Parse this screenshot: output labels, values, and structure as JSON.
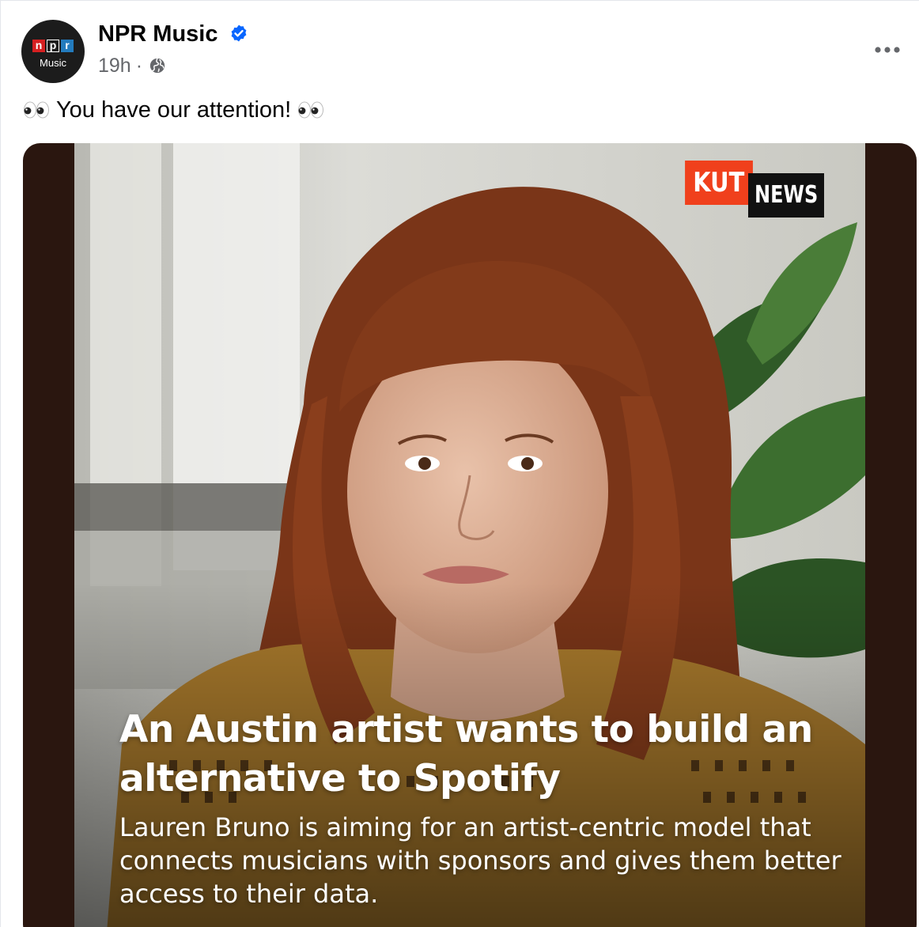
{
  "post": {
    "page_name": "NPR Music",
    "verified": true,
    "timestamp": "19h",
    "separator": "·",
    "audience_icon": "globe-icon",
    "more_icon": "more-options-icon",
    "caption_text": "You have our attention!",
    "caption_emoji": "eyes-emoji"
  },
  "avatar": {
    "logo_letters": [
      "n",
      "p",
      "r"
    ],
    "subtitle": "Music"
  },
  "media": {
    "badge_primary": "KUT",
    "badge_secondary": "NEWS",
    "headline": "An Austin artist wants to build an alternative to Spotify",
    "subheadline": "Lauren Bruno is aiming for an artist-centric model that connects musicians with sponsors and gives them better access to their data."
  },
  "colors": {
    "verified_blue": "#0866ff",
    "npr_red": "#d62021",
    "npr_blue": "#237bbd",
    "kut_orange": "#f0401c",
    "meta_gray": "#65676b"
  }
}
